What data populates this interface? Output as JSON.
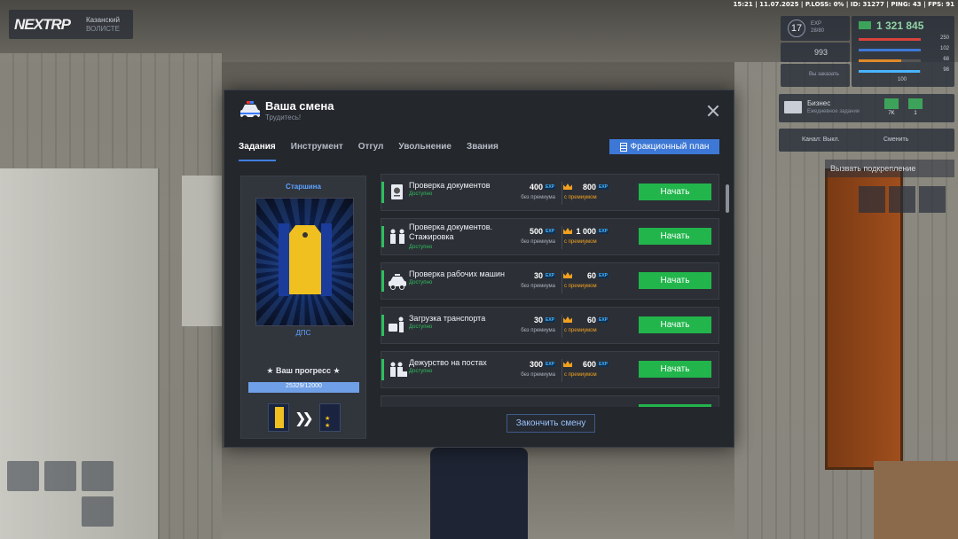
{
  "hud": {
    "topbar": "15:21 | 11.07.2025 | P.LOSS: 0% | ID: 31277 | PING: 43 | FPS: 91",
    "logo": "NEXTRP",
    "server_name": "Казанский",
    "server_sub": "ВОЛИСТЕ",
    "level": "17",
    "level_label": "EXP",
    "level_value": "28/80",
    "money": "1 321 845",
    "health": "250",
    "armor": "102",
    "hunger": "68",
    "thirst": "98",
    "ammo": "993",
    "ammo2": "100",
    "satiety_label": "Вы заказать",
    "business_title": "Бизнес",
    "business_sub": "Ежедневное задание",
    "business_v1": "7K",
    "business_v2": "1",
    "channel_label": "Канал: Выкл.",
    "channel_change": "Сменить",
    "call_backup": "Вызвать подкрепление"
  },
  "modal": {
    "title": "Ваша смена",
    "subtitle": "Трудитесь!",
    "tabs": [
      "Задания",
      "Инструмент",
      "Отгул",
      "Увольнение",
      "Звания"
    ],
    "plan_button": "Фракционный план",
    "rank": {
      "name": "Старшина",
      "department": "ДПС",
      "progress_label": "★ Ваш прогресс ★",
      "progress_text": "25329/12000",
      "progress_fraction": 1.0
    },
    "no_premium_label": "без премиума",
    "premium_label": "с премиумом",
    "exp_tag": "EXP",
    "start_label": "Начать",
    "tasks": [
      {
        "name": "Проверка документов",
        "status": "Доступно",
        "exp": "400",
        "exp_premium": "800",
        "icon": "documents-icon"
      },
      {
        "name": "Проверка документов. Стажировка",
        "status": "Доступно",
        "exp": "500",
        "exp_premium": "1 000",
        "icon": "officers-icon"
      },
      {
        "name": "Проверка рабочих машин",
        "status": "Доступно",
        "exp": "30",
        "exp_premium": "60",
        "icon": "police-car-icon"
      },
      {
        "name": "Загрузка транспорта",
        "status": "Доступно",
        "exp": "30",
        "exp_premium": "60",
        "icon": "loading-icon"
      },
      {
        "name": "Дежурство на постах",
        "status": "Доступно",
        "exp": "300",
        "exp_premium": "600",
        "icon": "patrol-icon"
      }
    ],
    "end_button": "Закончить смену"
  },
  "colors": {
    "accent_blue": "#3d78d6",
    "start_green": "#22b54c",
    "status_green": "#2fbf5f",
    "premium_orange": "#f0a020"
  }
}
